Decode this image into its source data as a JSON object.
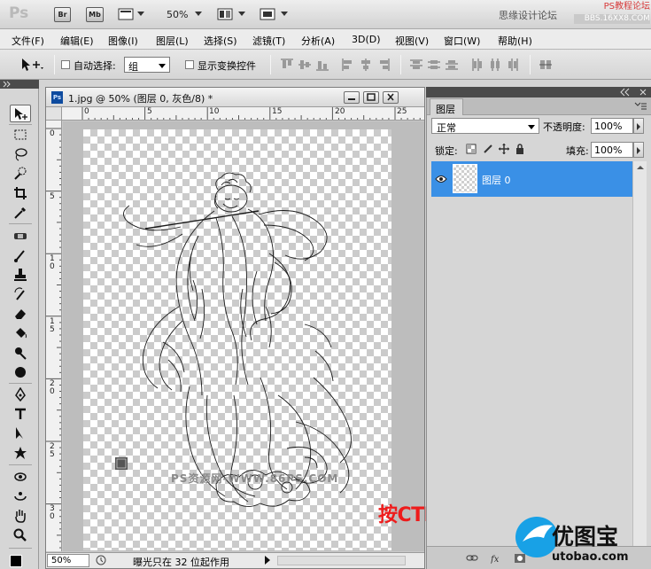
{
  "app": {
    "logo": "Ps",
    "bridge_label": "Br",
    "minibridge_label": "Mb",
    "zoom": "50%",
    "watermark_site": "思缘设计论坛",
    "watermark_ps": "PS教程论坛",
    "watermark_bbs": "BBS.16XX8.COM"
  },
  "menu": [
    "文件(F)",
    "编辑(E)",
    "图像(I)",
    "图层(L)",
    "选择(S)",
    "滤镜(T)",
    "分析(A)",
    "3D(D)",
    "视图(V)",
    "窗口(W)",
    "帮助(H)"
  ],
  "options": {
    "auto_select_label": "自动选择:",
    "auto_select_value": "组",
    "show_transform_label": "显示变换控件"
  },
  "document": {
    "title": "1.jpg @ 50% (图层 0, 灰色/8) *",
    "icon_label": "Ps",
    "ruler_h": [
      "0",
      "5",
      "10",
      "15",
      "20",
      "25"
    ],
    "ruler_v": [
      "0",
      "5",
      "1\n0",
      "1\n5",
      "2\n0",
      "2\n5",
      "3\n0"
    ],
    "canvas_watermark": "PS资源网-WWW.86PS.COM",
    "status_zoom": "50%",
    "status_text": "曝光只在 32 位起作用"
  },
  "overlay_caption": "按CTRL+D取消选区",
  "layers_panel": {
    "tab": "图层",
    "blend_mode": "正常",
    "opacity_label": "不透明度:",
    "opacity_value": "100%",
    "lock_label": "锁定:",
    "fill_label": "填充:",
    "fill_value": "100%",
    "layers": [
      {
        "name": "图层 0",
        "visible": true,
        "selected": true
      }
    ]
  },
  "brand": {
    "name_cn": "优图宝",
    "name_en": "utobao.com",
    "color": "#18a1e6"
  },
  "colors": {
    "accent_selection": "#3a90e6",
    "caption_red": "#ee1b1b"
  }
}
